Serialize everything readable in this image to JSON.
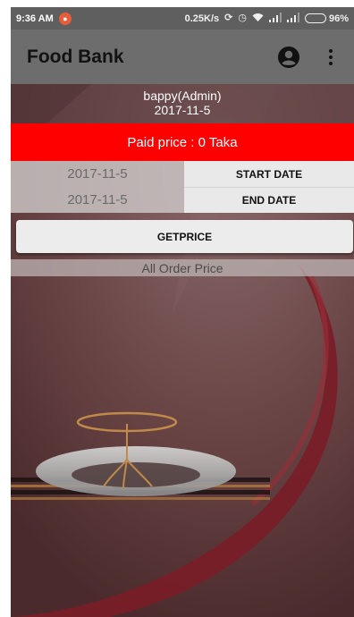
{
  "status_bar": {
    "time": "9:36 AM",
    "network_speed": "0.25K/s",
    "battery_percent": "96%",
    "battery_level": 0.96,
    "icons": [
      "notification-icon",
      "sync-icon",
      "alarm-icon",
      "wifi-icon",
      "signal-icon",
      "signal-icon",
      "battery-icon"
    ]
  },
  "app_bar": {
    "title": "Food Bank",
    "account_icon": "account-circle-icon",
    "menu_icon": "more-vert-icon"
  },
  "user": {
    "name": "bappy(Admin)",
    "date": "2017-11-5"
  },
  "paid": {
    "label": "Paid price :",
    "amount": "0 Taka"
  },
  "date_range": {
    "start_value": "2017-11-5",
    "start_button": "START DATE",
    "end_value": "2017-11-5",
    "end_button": "END DATE"
  },
  "getprice_button": "GETPRICE",
  "all_order_label": "All Order Price",
  "colors": {
    "status_bar": "#5f5f5f",
    "app_bar": "#6d6d6d",
    "paid_bar": "#ff0000",
    "background": "#6e4a4c"
  }
}
